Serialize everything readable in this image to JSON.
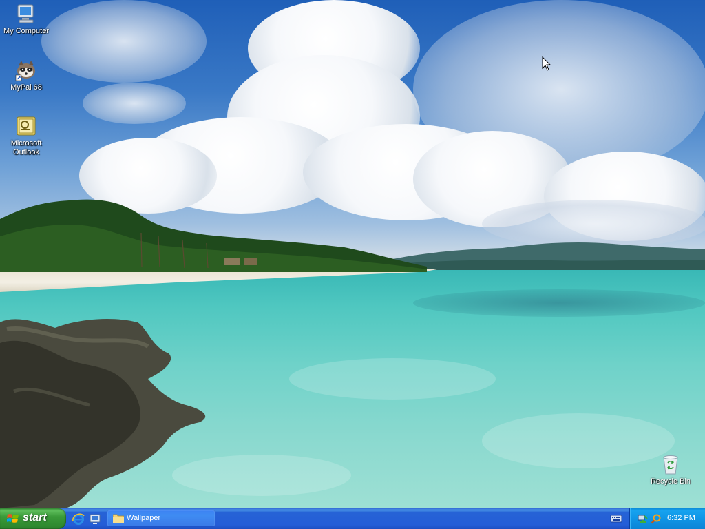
{
  "desktop": {
    "icons": [
      {
        "label": "My Computer",
        "icon": "my-computer-icon"
      },
      {
        "label": "MyPal 68",
        "icon": "mypal-raccoon-icon"
      },
      {
        "label": "Microsoft\nOutlook",
        "icon": "outlook-icon"
      },
      {
        "label": "Recycle Bin",
        "icon": "recycle-bin-icon"
      }
    ]
  },
  "taskbar": {
    "start_label": "start",
    "quick_launch": [
      "internet-explorer-icon",
      "show-desktop-icon"
    ],
    "windows": [
      {
        "title": "Wallpaper",
        "icon": "folder-icon"
      }
    ],
    "tray": {
      "icons": [
        "network-icon",
        "search-icon"
      ],
      "clock": "6:32 PM"
    }
  },
  "colors": {
    "taskbar_blue": "#245dd7",
    "start_green": "#3a9a39",
    "tray_blue": "#0f95e6"
  }
}
